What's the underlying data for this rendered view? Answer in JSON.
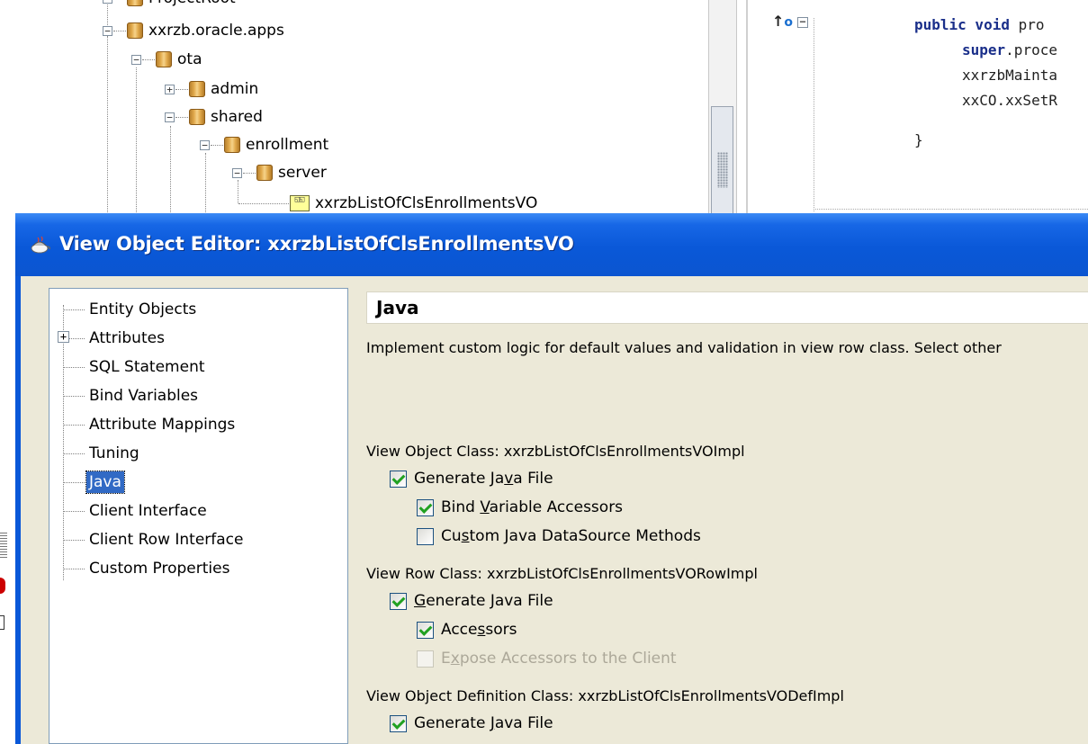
{
  "ide": {
    "tree": {
      "top_partial_label": "ProjectRoot",
      "items": [
        {
          "label": "xxrzb.oracle.apps",
          "toggle": "−"
        },
        {
          "label": "ota",
          "toggle": "−"
        },
        {
          "label": "admin",
          "toggle": "+"
        },
        {
          "label": "shared",
          "toggle": "−"
        },
        {
          "label": "enrollment",
          "toggle": "−"
        },
        {
          "label": "server",
          "toggle": "−"
        },
        {
          "label": "xxrzbListOfClsEnrollmentsVO",
          "toggle": ""
        }
      ]
    },
    "editor": {
      "override_marker": "↑o",
      "fold_toggle": "−",
      "code_lines": [
        {
          "keyword": "public void ",
          "text": "pro"
        },
        {
          "keyword": "super",
          "text": ".proce"
        },
        {
          "keyword": "",
          "text": "xxrzbMainta"
        },
        {
          "keyword": "",
          "text": "xxCO.xxSetR"
        },
        {
          "keyword": "",
          "text": "}"
        }
      ]
    }
  },
  "dialog": {
    "title": "View Object Editor: xxrzbListOfClsEnrollmentsVO",
    "nav": {
      "items": [
        {
          "label": "Entity Objects",
          "selected": false
        },
        {
          "label": "Attributes",
          "selected": false,
          "expandable": true,
          "toggle": "+"
        },
        {
          "label": "SQL Statement",
          "selected": false
        },
        {
          "label": "Bind Variables",
          "selected": false
        },
        {
          "label": "Attribute Mappings",
          "selected": false
        },
        {
          "label": "Tuning",
          "selected": false
        },
        {
          "label": "Java",
          "selected": true
        },
        {
          "label": "Client Interface",
          "selected": false
        },
        {
          "label": "Client Row Interface",
          "selected": false
        },
        {
          "label": "Custom Properties",
          "selected": false
        }
      ]
    },
    "content": {
      "section_title": "Java",
      "description": "Implement custom logic for default values and validation in view row class.  Select other",
      "groups": [
        {
          "label": "View Object Class: xxrzbListOfClsEnrollmentsVOImpl",
          "options": [
            {
              "pre": "Generate Ja",
              "mnemonic": "v",
              "post": "a File",
              "checked": true,
              "disabled": false,
              "indent": 1
            },
            {
              "pre": "Bind ",
              "mnemonic": "V",
              "post": "ariable Accessors",
              "checked": true,
              "disabled": false,
              "indent": 2
            },
            {
              "pre": "Cu",
              "mnemonic": "s",
              "post": "tom Java DataSource Methods",
              "checked": false,
              "disabled": false,
              "indent": 2
            }
          ]
        },
        {
          "label": "View Row Class: xxrzbListOfClsEnrollmentsVORowImpl",
          "options": [
            {
              "pre": "",
              "mnemonic": "G",
              "post": "enerate Java File",
              "checked": true,
              "disabled": false,
              "indent": 1
            },
            {
              "pre": "Acce",
              "mnemonic": "s",
              "post": "sors",
              "checked": true,
              "disabled": false,
              "indent": 2
            },
            {
              "pre": "E",
              "mnemonic": "x",
              "post": "pose Accessors to the Client",
              "checked": false,
              "disabled": true,
              "indent": 2
            }
          ]
        },
        {
          "label": "View Object Definition Class: xxrzbListOfClsEnrollmentsVODefImpl",
          "options": [
            {
              "pre": "Generate ",
              "mnemonic": "J",
              "post": "ava File",
              "checked": true,
              "disabled": false,
              "indent": 1
            }
          ]
        }
      ]
    }
  }
}
